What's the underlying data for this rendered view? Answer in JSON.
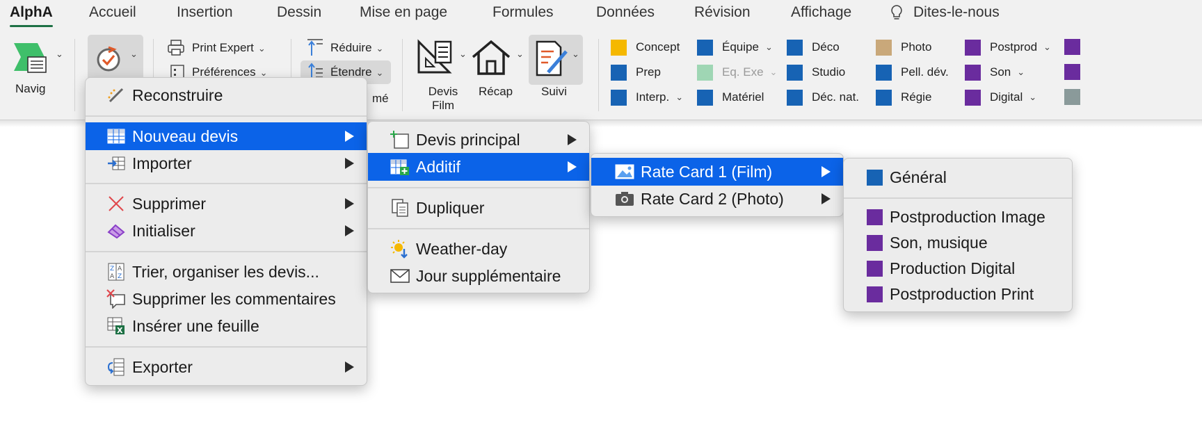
{
  "tabs": [
    {
      "label": "AlphA",
      "active": true
    },
    {
      "label": "Accueil"
    },
    {
      "label": "Insertion"
    },
    {
      "label": "Dessin"
    },
    {
      "label": "Mise en page"
    },
    {
      "label": "Formules"
    },
    {
      "label": "Données"
    },
    {
      "label": "Révision"
    },
    {
      "label": "Affichage"
    },
    {
      "label": "Dites-le-nous",
      "icon": "lightbulb-icon"
    }
  ],
  "ribbon": {
    "navig_label": "Navig",
    "print_expert": "Print Expert",
    "preferences": "Préférences",
    "reduire": "Réduire",
    "etendre": "Étendre",
    "hidden_label_tail": "mé",
    "devis_film_line1": "Devis",
    "devis_film_line2": "Film",
    "recap": "Récap",
    "suivi": "Suivi",
    "categories": [
      [
        {
          "label": "Concept",
          "color": "#f5b800",
          "dropdown": false
        },
        {
          "label": "Prep",
          "color": "#1763b4",
          "dropdown": false
        },
        {
          "label": "Interp.",
          "color": "#1763b4",
          "dropdown": true
        }
      ],
      [
        {
          "label": "Équipe",
          "color": "#1763b4",
          "dropdown": true
        },
        {
          "label": "Eq. Exe",
          "color": "#9fd6b4",
          "dropdown": true,
          "disabled": true
        },
        {
          "label": "Matériel",
          "color": "#1763b4",
          "dropdown": false
        }
      ],
      [
        {
          "label": "Déco",
          "color": "#1763b4",
          "dropdown": false
        },
        {
          "label": "Studio",
          "color": "#1763b4",
          "dropdown": false
        },
        {
          "label": "Déc. nat.",
          "color": "#1763b4",
          "dropdown": false
        }
      ],
      [
        {
          "label": "Photo",
          "color": "#c9a87a",
          "dropdown": false
        },
        {
          "label": "Pell. dév.",
          "color": "#1763b4",
          "dropdown": false
        },
        {
          "label": "Régie",
          "color": "#1763b4",
          "dropdown": false
        }
      ],
      [
        {
          "label": "Postprod",
          "color": "#6a2c9e",
          "dropdown": true
        },
        {
          "label": "Son",
          "color": "#6a2c9e",
          "dropdown": true
        },
        {
          "label": "Digital",
          "color": "#6a2c9e",
          "dropdown": true
        }
      ]
    ],
    "overflow_swatches": [
      "#6a2c9e",
      "#6a2c9e",
      "#8a9a9a"
    ]
  },
  "menu1": {
    "reconstruire": "Reconstruire",
    "nouveau_devis": "Nouveau devis",
    "importer": "Importer",
    "supprimer": "Supprimer",
    "initialiser": "Initialiser",
    "trier": "Trier, organiser les devis...",
    "supprimer_commentaires": "Supprimer les commentaires",
    "inserer_feuille": "Insérer une feuille",
    "exporter": "Exporter"
  },
  "menu2": {
    "devis_principal": "Devis principal",
    "additif": "Additif",
    "dupliquer": "Dupliquer",
    "weather_day": "Weather-day",
    "jour_supplementaire": "Jour supplémentaire"
  },
  "menu3": {
    "rate_card_1": "Rate Card 1 (Film)",
    "rate_card_2": "Rate Card 2 (Photo)"
  },
  "menu4": {
    "items": [
      {
        "label": "Général",
        "color": "#1763b4"
      },
      {
        "label": "Postproduction Image",
        "color": "#6a2c9e"
      },
      {
        "label": "Son, musique",
        "color": "#6a2c9e"
      },
      {
        "label": "Production Digital",
        "color": "#6a2c9e"
      },
      {
        "label": "Postproduction Print",
        "color": "#6a2c9e"
      }
    ]
  },
  "colors": {
    "accent_tab": "#1e7145",
    "menu_highlight": "#0b63e8",
    "blue": "#1763b4",
    "purple": "#6a2c9e"
  }
}
